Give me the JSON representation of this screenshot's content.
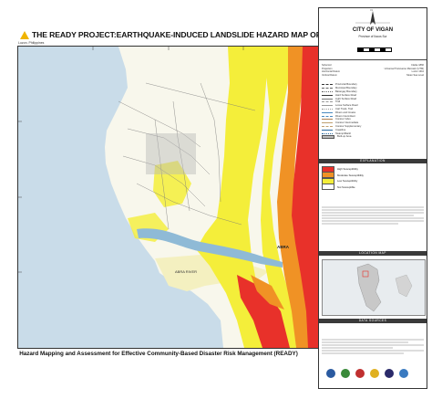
{
  "title": "THE READY PROJECT:EARTHQUAKE-INDUCED LANDSLIDE HAZARD MAP OF VIGAN CITY",
  "location_note": "Luzon, Philippines",
  "footer": "Hazard Mapping and Assessment for Effective Community-Based Disaster Risk Management  (READY)",
  "map_labels": {
    "abra": "ABRA",
    "river": "ABRA RIVER"
  },
  "panel": {
    "city": "CITY OF VIGAN",
    "province": "Province of Ilocos Sur",
    "info": [
      [
        "Spheroid",
        "Clarke 1866"
      ],
      [
        "Projection",
        "Universal Transverse Mercator (UTM)"
      ],
      [
        "Horizontal Datum",
        "Luzon 1911"
      ],
      [
        "Vertical Datum",
        "Mean Sea Level"
      ]
    ],
    "legend_items": [
      "Provincial Boundary",
      "Municipal Boundary",
      "Barangay Boundary",
      "Hard Surface Road",
      "Light Surface Road",
      "Trail",
      "Loose Surface Road",
      "Cart Track, Trail",
      "Rivers and Creeks",
      "Rivers Intermittent",
      "Contour Index",
      "Contour Intermediate",
      "Contour Supplementary",
      "Coastline",
      "Swamp/Marsh",
      "Built-up Area"
    ],
    "hazard_header": "EXPLANATION",
    "hazard": [
      {
        "label": "High Susceptibility",
        "color": "#e8312a"
      },
      {
        "label": "Moderate Susceptibility",
        "color": "#f09225"
      },
      {
        "label": "Low Susceptibility",
        "color": "#f4ee3a"
      },
      {
        "label": "Not Susceptible",
        "color": "#ffffff"
      }
    ],
    "location_header": "LOCATION MAP",
    "credits_header": "DATA SOURCES"
  }
}
